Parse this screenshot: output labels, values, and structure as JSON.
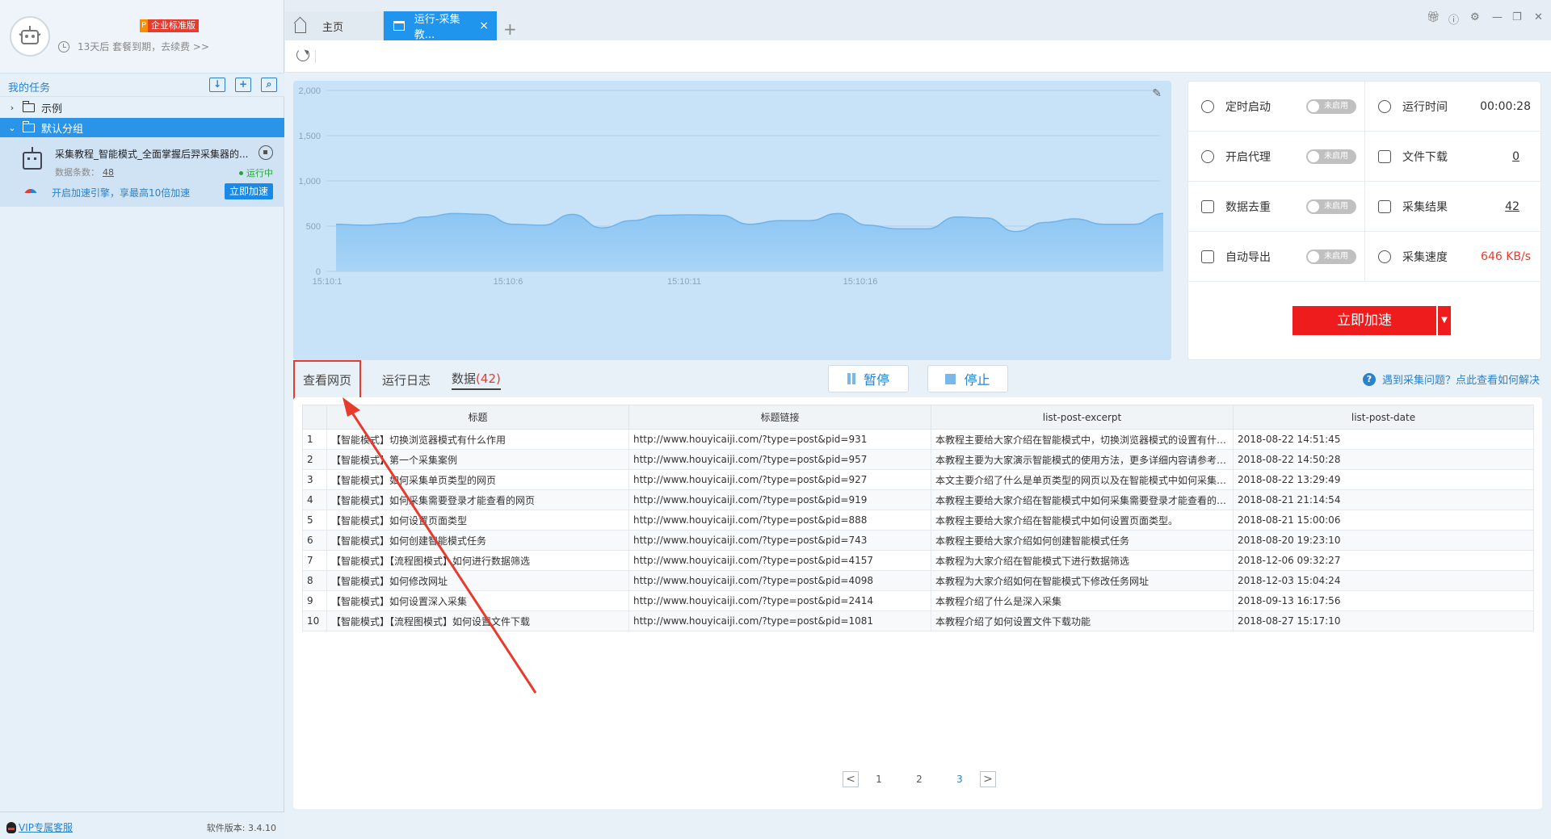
{
  "profile": {
    "badge_p": "P",
    "edition": "企业标准版",
    "expire_text": "13天后 套餐到期，去续费 >>"
  },
  "sidebar": {
    "my_tasks": "我的任务",
    "groups": [
      {
        "label": "示例",
        "expanded": false
      },
      {
        "label": "默认分组",
        "expanded": true
      }
    ],
    "task": {
      "name": "采集教程_智能模式_全面掌握后羿采集器的...",
      "count_label": "数据条数：",
      "count": "48",
      "status": "运行中",
      "accel_text": "开启加速引擎，享最高10倍加速",
      "accel_button": "立即加速"
    },
    "vip": "VIP专属客服",
    "version": "软件版本: 3.4.10"
  },
  "tabs": {
    "home": "主页",
    "run": "运行-采集教...",
    "close": "×",
    "add": "+"
  },
  "chart_data": {
    "type": "area",
    "x_ticks": [
      "15:10:1",
      "15:10:6",
      "15:10:11",
      "15:10:16"
    ],
    "y_ticks": [
      "0",
      "500",
      "1,000",
      "1,500",
      "2,000"
    ],
    "ylim": [
      0,
      2000
    ],
    "series": [
      {
        "values": [
          520,
          510,
          530,
          600,
          640,
          630,
          520,
          510,
          630,
          480,
          560,
          620,
          625,
          620,
          520,
          560,
          560,
          640,
          510,
          470,
          470,
          600,
          590,
          440,
          540,
          580,
          520,
          520,
          640
        ]
      }
    ],
    "grid": true
  },
  "stats": {
    "timer_start": {
      "label": "定时启动",
      "state": "未启用"
    },
    "run_time": {
      "label": "运行时间",
      "value": "00:00:28"
    },
    "proxy": {
      "label": "开启代理",
      "state": "未启用"
    },
    "file_download": {
      "label": "文件下载",
      "value": "0"
    },
    "dedup": {
      "label": "数据去重",
      "state": "未启用"
    },
    "result": {
      "label": "采集结果",
      "value": "42"
    },
    "auto_export": {
      "label": "自动导出",
      "state": "未启用"
    },
    "speed": {
      "label": "采集速度",
      "value": "646 KB/s"
    },
    "accelerate": "立即加速"
  },
  "lower_tabs": {
    "view_page": "查看网页",
    "run_log": "运行日志",
    "data": "数据",
    "data_count": "(42)",
    "pause": "暂停",
    "stop": "停止",
    "help": "遇到采集问题？点此查看如何解决"
  },
  "table": {
    "headers": [
      "",
      "标题",
      "标题链接",
      "list-post-excerpt",
      "list-post-date"
    ],
    "rows": [
      [
        "1",
        "【智能模式】切换浏览器模式有什么作用",
        "http://www.houyicaiji.com/?type=post&pid=931",
        "本教程主要给大家介绍在智能模式中，切换浏览器模式的设置有什么...",
        "2018-08-22 14:51:45"
      ],
      [
        "2",
        "【智能模式】第一个采集案例",
        "http://www.houyicaiji.com/?type=post&pid=957",
        "本教程主要为大家演示智能模式的使用方法，更多详细内容请参考智...",
        "2018-08-22 14:50:28"
      ],
      [
        "3",
        "【智能模式】如何采集单页类型的网页",
        "http://www.houyicaiji.com/?type=post&pid=927",
        "本文主要介绍了什么是单页类型的网页以及在智能模式中如何采集单...",
        "2018-08-22 13:29:49"
      ],
      [
        "4",
        "【智能模式】如何采集需要登录才能查看的网页",
        "http://www.houyicaiji.com/?type=post&pid=919",
        "本教程主要给大家介绍在智能模式中如何采集需要登录才能查看的网...",
        "2018-08-21 21:14:54"
      ],
      [
        "5",
        "【智能模式】如何设置页面类型",
        "http://www.houyicaiji.com/?type=post&pid=888",
        "本教程主要给大家介绍在智能模式中如何设置页面类型。",
        "2018-08-21 15:00:06"
      ],
      [
        "6",
        "【智能模式】如何创建智能模式任务",
        "http://www.houyicaiji.com/?type=post&pid=743",
        "本教程主要给大家介绍如何创建智能模式任务",
        "2018-08-20 19:23:10"
      ],
      [
        "7",
        "【智能模式】【流程图模式】如何进行数据筛选",
        "http://www.houyicaiji.com/?type=post&pid=4157",
        "本教程为大家介绍在智能模式下进行数据筛选",
        "2018-12-06 09:32:27"
      ],
      [
        "8",
        "【智能模式】如何修改网址",
        "http://www.houyicaiji.com/?type=post&pid=4098",
        "本教程为大家介绍如何在智能模式下修改任务网址",
        "2018-12-03 15:04:24"
      ],
      [
        "9",
        "【智能模式】如何设置深入采集",
        "http://www.houyicaiji.com/?type=post&pid=2414",
        "本教程介绍了什么是深入采集",
        "2018-09-13 16:17:56"
      ],
      [
        "10",
        "【智能模式】【流程图模式】如何设置文件下载",
        "http://www.houyicaiji.com/?type=post&pid=1081",
        "本教程介绍了如何设置文件下载功能",
        "2018-08-27 15:17:10"
      ]
    ]
  },
  "pager": {
    "prev": "<",
    "pages": [
      "1",
      "2",
      "3"
    ],
    "current": "3",
    "next": ">"
  },
  "colors": {
    "accent": "#1f95ee",
    "alert": "#ee1c1c",
    "annotation": "#e63b2e"
  }
}
